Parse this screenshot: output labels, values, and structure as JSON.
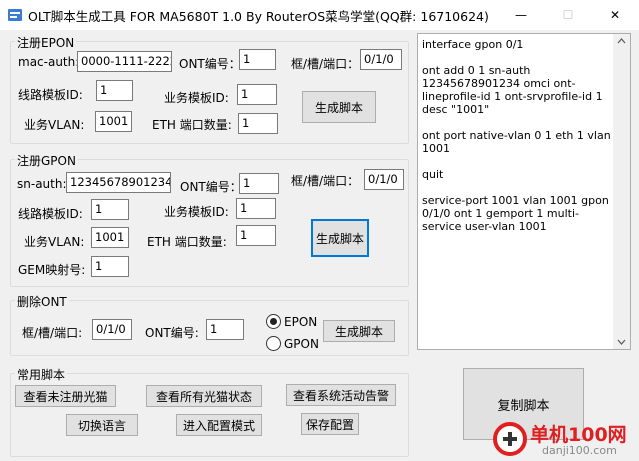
{
  "window": {
    "title": "OLT脚本生成工具 FOR MA5680T 1.0 By RouterOS菜鸟学堂(QQ群: 16710624)",
    "minimize_glyph": "—",
    "maximize_glyph": "☐",
    "close_glyph": "✕"
  },
  "epon_register": {
    "group_label": "注册EPON",
    "mac_auth_label": "mac-auth:",
    "mac_auth_value": "0000-1111-2222",
    "ont_id_label": "ONT编号：",
    "ont_id_value": "1",
    "frame_slot_port_label": "框/槽/端口：",
    "frame_slot_port_value": "0/1/0",
    "line_profile_label": "线路模板ID:",
    "line_profile_value": "1",
    "srv_profile_label": "业务模板ID:",
    "srv_profile_value": "1",
    "vlan_label": "业务VLAN:",
    "vlan_value": "1001",
    "eth_count_label": "ETH 端口数量:",
    "eth_count_value": "1",
    "generate_label": "生成脚本"
  },
  "gpon_register": {
    "group_label": "注册GPON",
    "sn_auth_label": "sn-auth:",
    "sn_auth_value": "12345678901234",
    "ont_id_label": "ONT编号：",
    "ont_id_value": "1",
    "frame_slot_port_label": "框/槽/端口：",
    "frame_slot_port_value": "0/1/0",
    "line_profile_label": "线路模板ID:",
    "line_profile_value": "1",
    "srv_profile_label": "业务模板ID:",
    "srv_profile_value": "1",
    "vlan_label": "业务VLAN:",
    "vlan_value": "1001",
    "eth_count_label": "ETH 端口数量:",
    "eth_count_value": "1",
    "gem_label": "GEM映射号:",
    "gem_value": "1",
    "generate_label": "生成脚本"
  },
  "delete_ont": {
    "group_label": "删除ONT",
    "frame_slot_port_label": "框/槽/端口:",
    "frame_slot_port_value": "0/1/0",
    "ont_id_label": "ONT编号:",
    "ont_id_value": "1",
    "radio_epon": "EPON",
    "radio_gpon": "GPON",
    "generate_label": "生成脚本"
  },
  "common": {
    "group_label": "常用脚本",
    "btn_unregistered": "查看未注册光猫",
    "btn_all_status": "查看所有光猫状态",
    "btn_alarms": "查看系统活动告警",
    "btn_language": "切换语言",
    "btn_config_mode": "进入配置模式",
    "btn_save": "保存配置"
  },
  "output": {
    "script_text": "interface gpon 0/1\n\nont add 0 1 sn-auth 12345678901234 omci ont-lineprofile-id 1 ont-srvprofile-id 1 desc \"1001\"\n\nont port native-vlan 0 1 eth 1 vlan 1001\n\nquit\n\nservice-port 1001 vlan 1001 gpon 0/1/0 ont 1 gemport 1 multi-service user-vlan 1001"
  },
  "copy_button_label": "复制脚本",
  "watermark": {
    "text": "单机100网",
    "url": "danji100.com"
  },
  "colors": {
    "window_bg": "#f0f0f0",
    "accent": "#0078d7",
    "watermark_red": "#e02020"
  }
}
